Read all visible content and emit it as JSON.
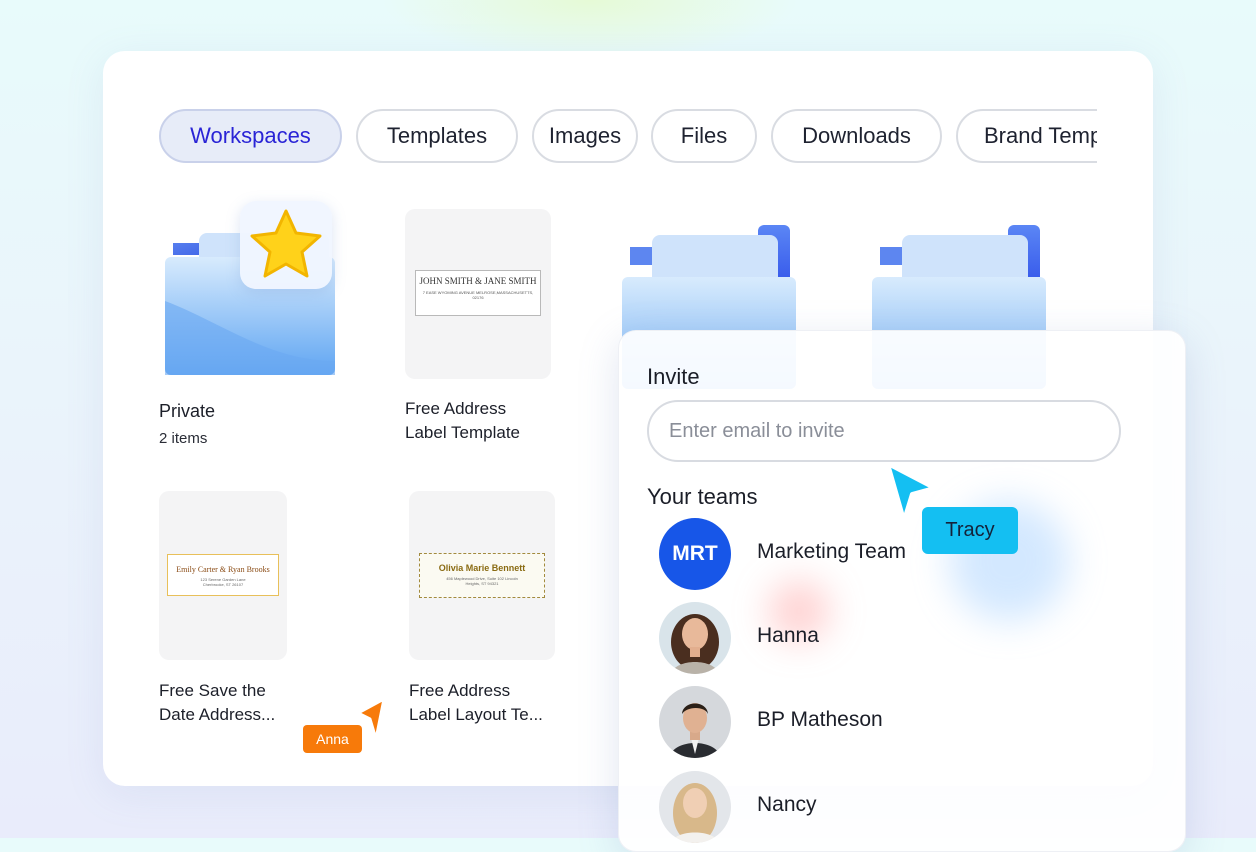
{
  "tabs": [
    {
      "label": "Workspaces",
      "active": true
    },
    {
      "label": "Templates",
      "active": false
    },
    {
      "label": "Images",
      "active": false
    },
    {
      "label": "Files",
      "active": false
    },
    {
      "label": "Downloads",
      "active": false
    },
    {
      "label": "Brand Templates",
      "active": false
    }
  ],
  "cards": {
    "private": {
      "title": "Private",
      "subtitle": "2 items"
    },
    "address_label": {
      "title_line1": "Free Address",
      "title_line2": "Label Template",
      "preview_name": "JOHN SMITH & JANE SMITH",
      "preview_address": "7 EASE WYOMING AVENUE MELROSE,MASSACHUSETTS, 02176"
    },
    "save_the_date": {
      "title_line1": "Free Save the",
      "title_line2": "Date Address...",
      "preview_name": "Emily Carter & Ryan Brooks",
      "preview_address": "123 Serene Garden Lane Cherbrooke, ST 26107"
    },
    "address_layout": {
      "title_line1": "Free Address",
      "title_line2": "Label Layout Te...",
      "preview_name": "Olivia Marie Bennett",
      "preview_address": "456 Maplewood Drive, Suite 102 Lincoln Heights, ST 94321"
    }
  },
  "invite": {
    "title": "Invite",
    "email_placeholder": "Enter email to invite",
    "teams_title": "Your teams",
    "members": [
      {
        "name": "Marketing Team",
        "initials": "MRT"
      },
      {
        "name": "Hanna"
      },
      {
        "name": "BP Matheson"
      },
      {
        "name": "Nancy"
      }
    ]
  },
  "cursors": [
    {
      "name": "Tracy",
      "color": "#14bff2"
    },
    {
      "name": "Anna",
      "color": "#f77a0a"
    }
  ],
  "colors": {
    "accent": "#2a24d6",
    "team_avatar": "#1756e8",
    "folder_blue": "#5fa5f2"
  },
  "icons": {
    "favorite": "star-icon",
    "folder": "folder-icon",
    "cursor": "pointer-cursor-icon"
  }
}
